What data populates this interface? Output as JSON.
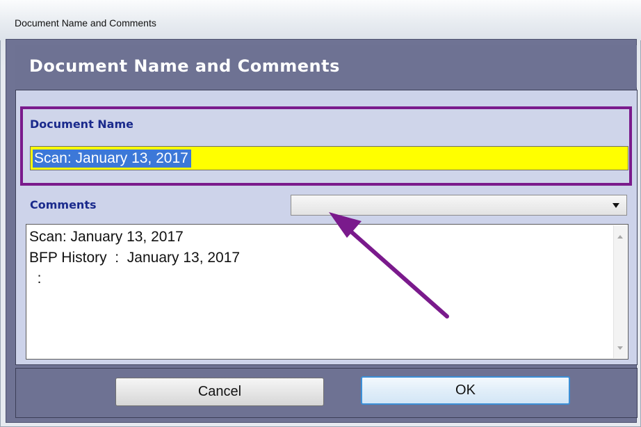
{
  "window": {
    "title": "Document Name and Comments"
  },
  "header": {
    "title": "Document Name and Comments"
  },
  "document_name": {
    "label": "Document Name",
    "value": "Scan: January 13, 2017"
  },
  "comments": {
    "label": "Comments",
    "dropdown_selected": "",
    "lines": [
      "Scan: January 13, 2017",
      "BFP History  :  January 13, 2017",
      "  :"
    ]
  },
  "buttons": {
    "cancel_label": "Cancel",
    "ok_label": "OK"
  },
  "colors": {
    "header_bg": "#6e7293",
    "panel_bg": "#cdd3ea",
    "highlight_border": "#7a1a8c",
    "name_field_bg": "#ffff00",
    "selection": "#3c78d8",
    "annotation_arrow": "#7a1a8c"
  }
}
